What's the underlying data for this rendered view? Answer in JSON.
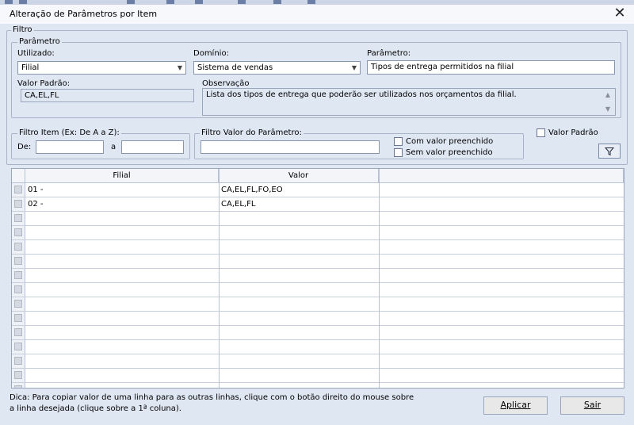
{
  "window": {
    "title": "Alteração de Parâmetros por Item",
    "close_glyph": "✕"
  },
  "filtro": {
    "legend": "Filtro",
    "parametro_group": {
      "legend": "Parâmetro",
      "utilizado": {
        "label": "Utilizado:",
        "value": "Filial"
      },
      "dominio": {
        "label": "Domínio:",
        "value": "Sistema de vendas"
      },
      "parametro": {
        "label": "Parâmetro:",
        "value": "Tipos de entrega permitidos na filial"
      },
      "valor_padrao": {
        "label": "Valor Padrão:",
        "value": "CA,EL,FL"
      },
      "observacao": {
        "label": "Observação",
        "value": "Lista dos tipos de entrega que poderão ser utilizados nos orçamentos da filial."
      }
    },
    "filtro_item": {
      "legend": "Filtro Item (Ex: De A a Z):",
      "de_label": "De:",
      "de_value": "",
      "a_label": "a",
      "a_value": ""
    },
    "filtro_valor": {
      "legend": "Filtro Valor do Parâmetro:",
      "value": "",
      "com_valor": "Com valor preenchido",
      "sem_valor": "Sem valor preenchido"
    },
    "valor_padrao_check": "Valor Padrão",
    "filter_icon": "filter-icon"
  },
  "grid": {
    "columns": [
      "Filial",
      "Valor"
    ],
    "rows": [
      {
        "filial": "01 -",
        "valor": "CA,EL,FL,FO,EO"
      },
      {
        "filial": "02 -",
        "valor": "CA,EL,FL"
      }
    ],
    "empty_rows": 13
  },
  "footer": {
    "hint_line1": "Dica: Para copiar valor de uma linha para as outras linhas, clique com o botão direito do mouse sobre",
    "hint_line2": "a linha desejada (clique sobre a 1ª coluna).",
    "apply_label": "Aplicar",
    "exit_label": "Sair"
  },
  "colors": {
    "background": "#dfe7f3",
    "border": "#a9b4c7"
  }
}
